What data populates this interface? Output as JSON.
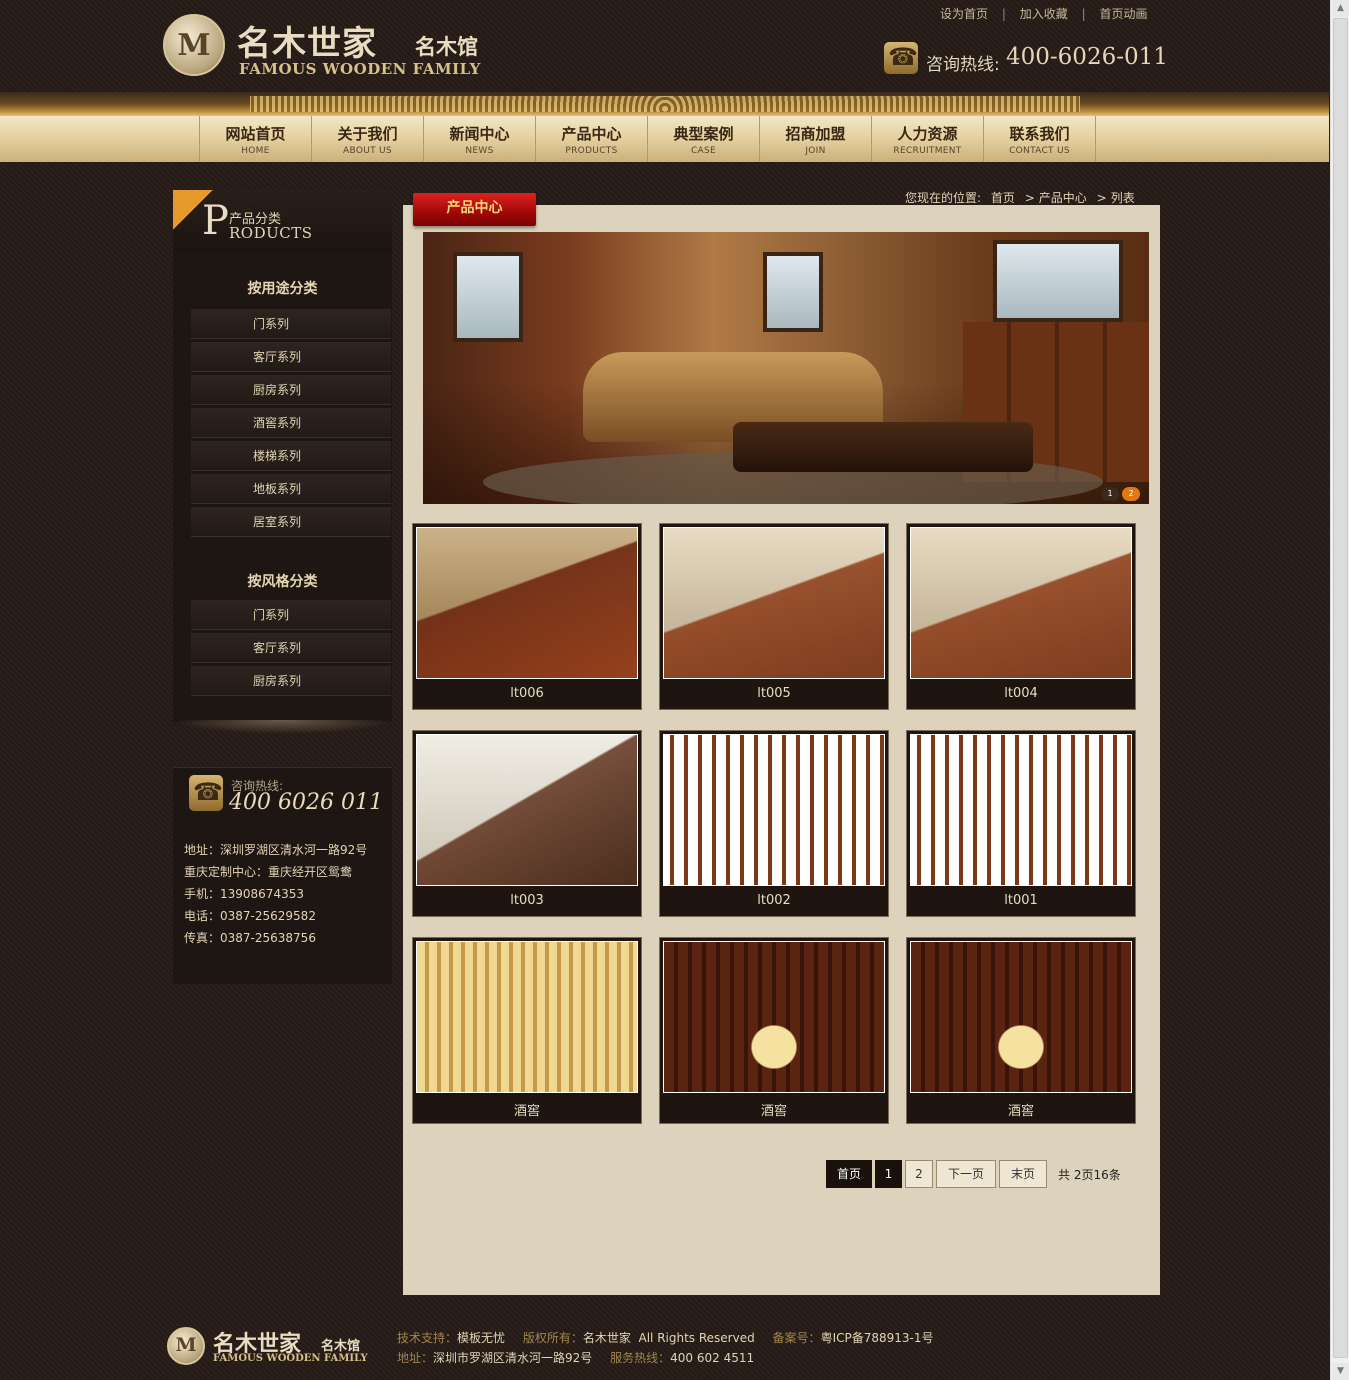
{
  "brand": {
    "logo_letter": "M",
    "name_cn": "名木世家",
    "name_cn_small": "名木馆",
    "name_en": "FAMOUS WOODEN FAMILY"
  },
  "top_links": [
    "设为首页",
    "加入收藏",
    "首页动画"
  ],
  "top_link_sep": "|",
  "hotline": {
    "label": "咨询热线:",
    "number": "400-6026-011"
  },
  "nav": [
    {
      "cn": "网站首页",
      "en": "HOME"
    },
    {
      "cn": "关于我们",
      "en": "ABOUT US"
    },
    {
      "cn": "新闻中心",
      "en": "NEWS"
    },
    {
      "cn": "产品中心",
      "en": "PRODUCTS"
    },
    {
      "cn": "典型案例",
      "en": "CASE"
    },
    {
      "cn": "招商加盟",
      "en": "JOIN"
    },
    {
      "cn": "人力资源",
      "en": "RECRUITMENT"
    },
    {
      "cn": "联系我们",
      "en": "CONTACT US"
    }
  ],
  "sidebar": {
    "title_initial": "P",
    "title_cn": "产品分类",
    "title_en": "RODUCTS",
    "group1_heading": "按用途分类",
    "group1_items": [
      "门系列",
      "客厅系列",
      "厨房系列",
      "酒窖系列",
      "楼梯系列",
      "地板系列",
      "居室系列"
    ],
    "group2_heading": "按风格分类",
    "group2_items": [
      "门系列",
      "客厅系列",
      "厨房系列"
    ]
  },
  "contact": {
    "label": "咨询热线:",
    "number": "400 6026 011",
    "lines": [
      "地址：深圳罗湖区清水河一路92号",
      "重庆定制中心：重庆经开区鸳鸯",
      "手机：13908674353",
      "电话：0387-25629582",
      "传真：0387-25638756"
    ]
  },
  "section_tab": "产品中心",
  "breadcrumb": {
    "prefix": "您现在的位置:",
    "items": [
      "首页",
      "产品中心",
      "列表"
    ],
    "sep": ">"
  },
  "banner_dots": [
    "1",
    "2"
  ],
  "products": [
    "lt006",
    "lt005",
    "lt004",
    "lt003",
    "lt002",
    "lt001",
    "酒窖",
    "酒窖",
    "酒窖"
  ],
  "pagination": {
    "first": "首页",
    "pages": [
      "1",
      "2"
    ],
    "current_page": 1,
    "next": "下一页",
    "last": "末页",
    "total": "共 2页16条"
  },
  "footer": {
    "line1": [
      {
        "k": "技术支持：",
        "v": "模板无忧"
      },
      {
        "k": "版权所有：",
        "v": "名木世家  All Rights Reserved"
      },
      {
        "k": "备案号：",
        "v": "粤ICP备788913-1号"
      }
    ],
    "line2": [
      {
        "k": "地址：",
        "v": "深圳市罗湖区清水河一路92号"
      },
      {
        "k": "服务热线：",
        "v": "400 602 4511"
      }
    ]
  }
}
